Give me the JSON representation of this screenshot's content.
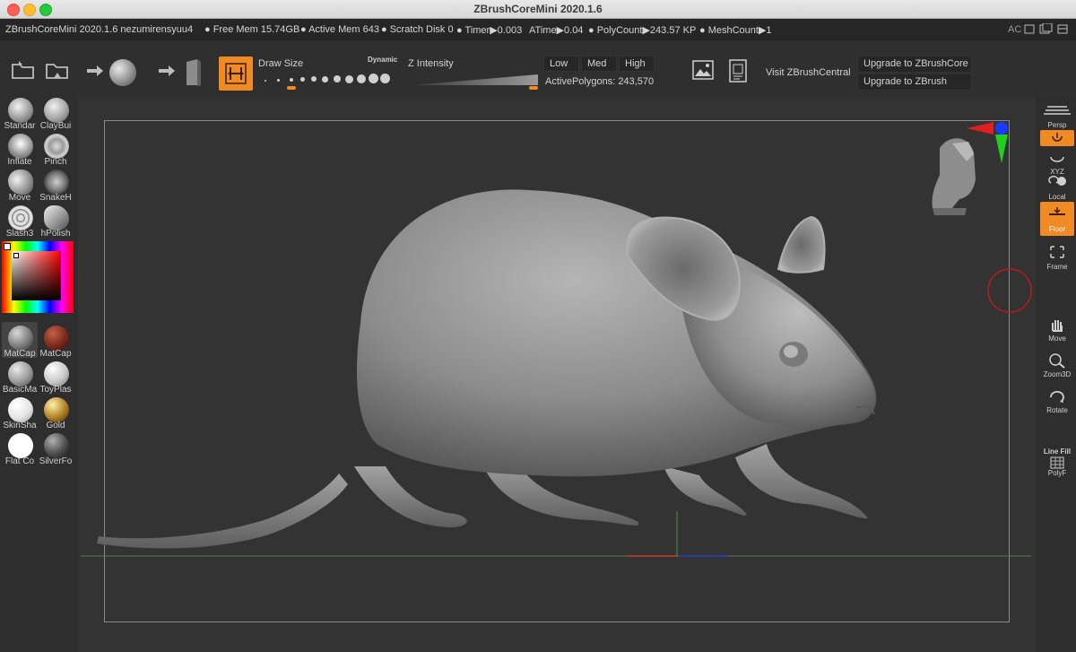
{
  "window": {
    "title": "ZBrushCoreMini 2020.1.6"
  },
  "infobar": {
    "app": "ZBrushCoreMini 2020.1.6 nezumirensyuu4",
    "free_mem": "● Free Mem 15.74GB",
    "active_mem": "● Active Mem 643",
    "scratch": "● Scratch Disk 0",
    "timer": "● Timer▶0.003",
    "atime": "ATime▶0.04",
    "polycount": "● PolyCount▶243.57 KP",
    "meshcount": "● MeshCount▶1",
    "ac": "AC"
  },
  "toolbar": {
    "draw_size_label": "Draw Size",
    "dynamic_label": "Dynamic",
    "z_intensity_label": "Z Intensity",
    "low": "Low",
    "med": "Med",
    "high": "High",
    "active_polygons": "ActivePolygons: 243,570",
    "visit": "Visit ZBrushCentral",
    "upgrade_core": "Upgrade to ZBrushCore",
    "upgrade_zbrush": "Upgrade to ZBrush"
  },
  "brushes": [
    {
      "label": "Standar"
    },
    {
      "label": "ClayBui"
    },
    {
      "label": "Inflate"
    },
    {
      "label": "Pinch"
    },
    {
      "label": "Move"
    },
    {
      "label": "SnakeH"
    },
    {
      "label": "Slash3"
    },
    {
      "label": "hPolish"
    }
  ],
  "materials": [
    {
      "label": "MatCap",
      "color": "#8a8a8a"
    },
    {
      "label": "MatCap",
      "color": "#7a2a1c"
    },
    {
      "label": "BasicMa",
      "color": "#9a9a9a"
    },
    {
      "label": "ToyPlas",
      "color": "#c8c8c8"
    },
    {
      "label": "SkinSha",
      "color": "#e5e5e5"
    },
    {
      "label": "Gold",
      "color": "#b88a2a"
    },
    {
      "label": "Flat Co",
      "color": "#ffffff"
    },
    {
      "label": "SilverFo",
      "color": "#555555"
    }
  ],
  "right_panel": {
    "persp": "Persp",
    "xyz": "XYZ",
    "local": "Local",
    "floor": "Floor",
    "frame": "Frame",
    "move": "Move",
    "zoom3d": "Zoom3D",
    "rotate": "Rotate",
    "line_fill": "Line Fill",
    "polyf": "PolyF"
  },
  "colors": {
    "accent": "#f08a24",
    "bg": "#2b2b2b",
    "canvas": "#333333"
  }
}
